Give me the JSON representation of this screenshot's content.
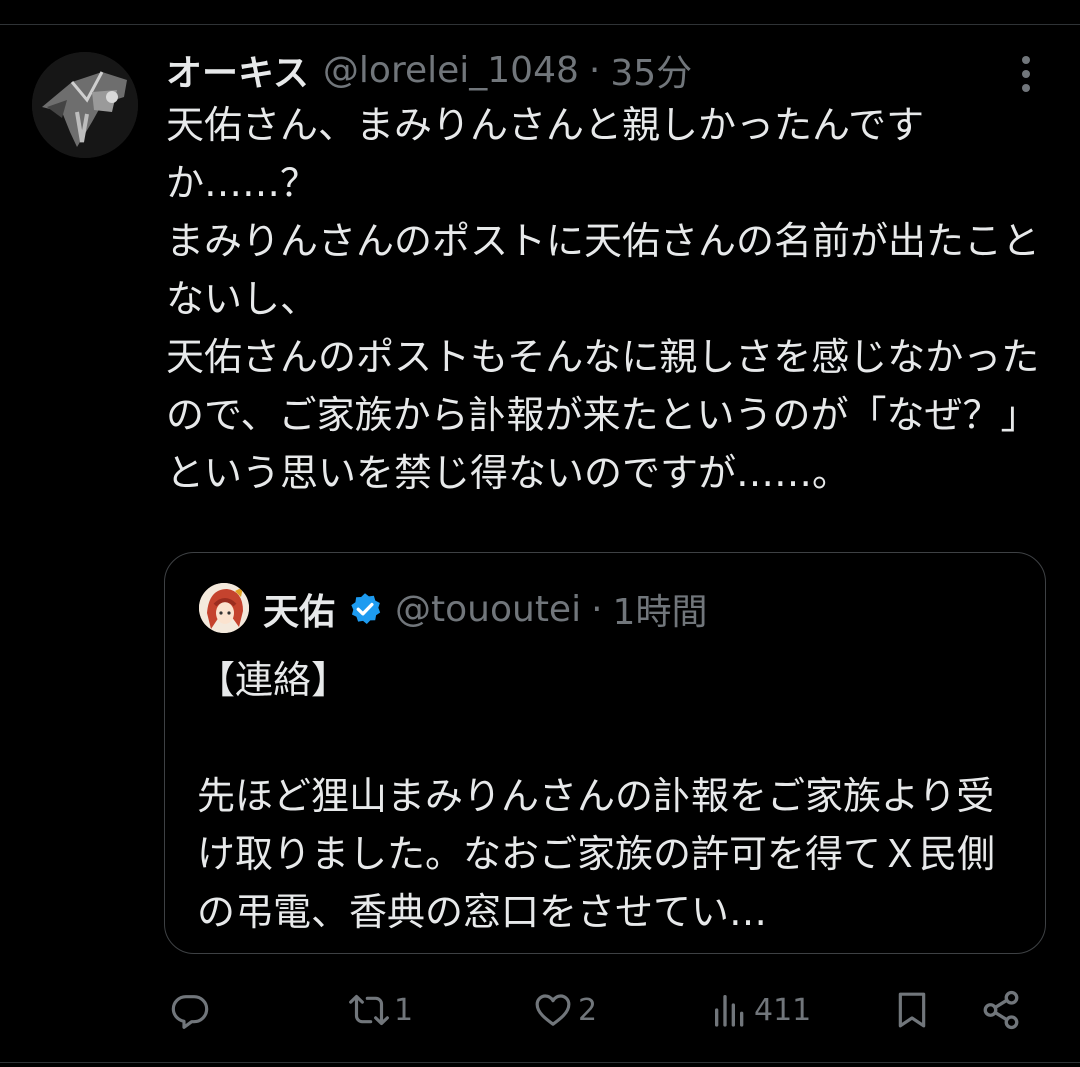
{
  "tweet": {
    "display_name": "オーキス",
    "handle": "@lorelei_1048",
    "separator": "·",
    "time": "35分",
    "text": "天佑さん、まみりんさんと親しかったんですか……？\nまみりんさんのポストに天佑さんの名前が出たことないし、\n天佑さんのポストもそんなに親しさを感じなかったので、ご家族から訃報が来たというのが「なぜ？」という思いを禁じ得ないのですが……。"
  },
  "quote": {
    "display_name": "天佑",
    "handle": "@tououtei",
    "separator": "·",
    "time": "1時間",
    "text": "【連絡】\n\n先ほど狸山まみりんさんの訃報をご家族より受け取りました。なおご家族の許可を得てＸ民側の弔電、香典の窓口をさせてい…"
  },
  "actions": {
    "reply_count": "",
    "retweet_count": "1",
    "like_count": "2",
    "views_count": "411"
  },
  "icons": {
    "more": "more-icon",
    "verified": "verified-icon",
    "reply": "reply-icon",
    "retweet": "retweet-icon",
    "like": "heart-icon",
    "views": "views-icon",
    "bookmark": "bookmark-icon",
    "share": "share-icon"
  },
  "colors": {
    "background": "#000000",
    "text": "#e7e9ea",
    "muted": "#71767b",
    "border": "#3e4144",
    "verified": "#1d9bf0"
  }
}
